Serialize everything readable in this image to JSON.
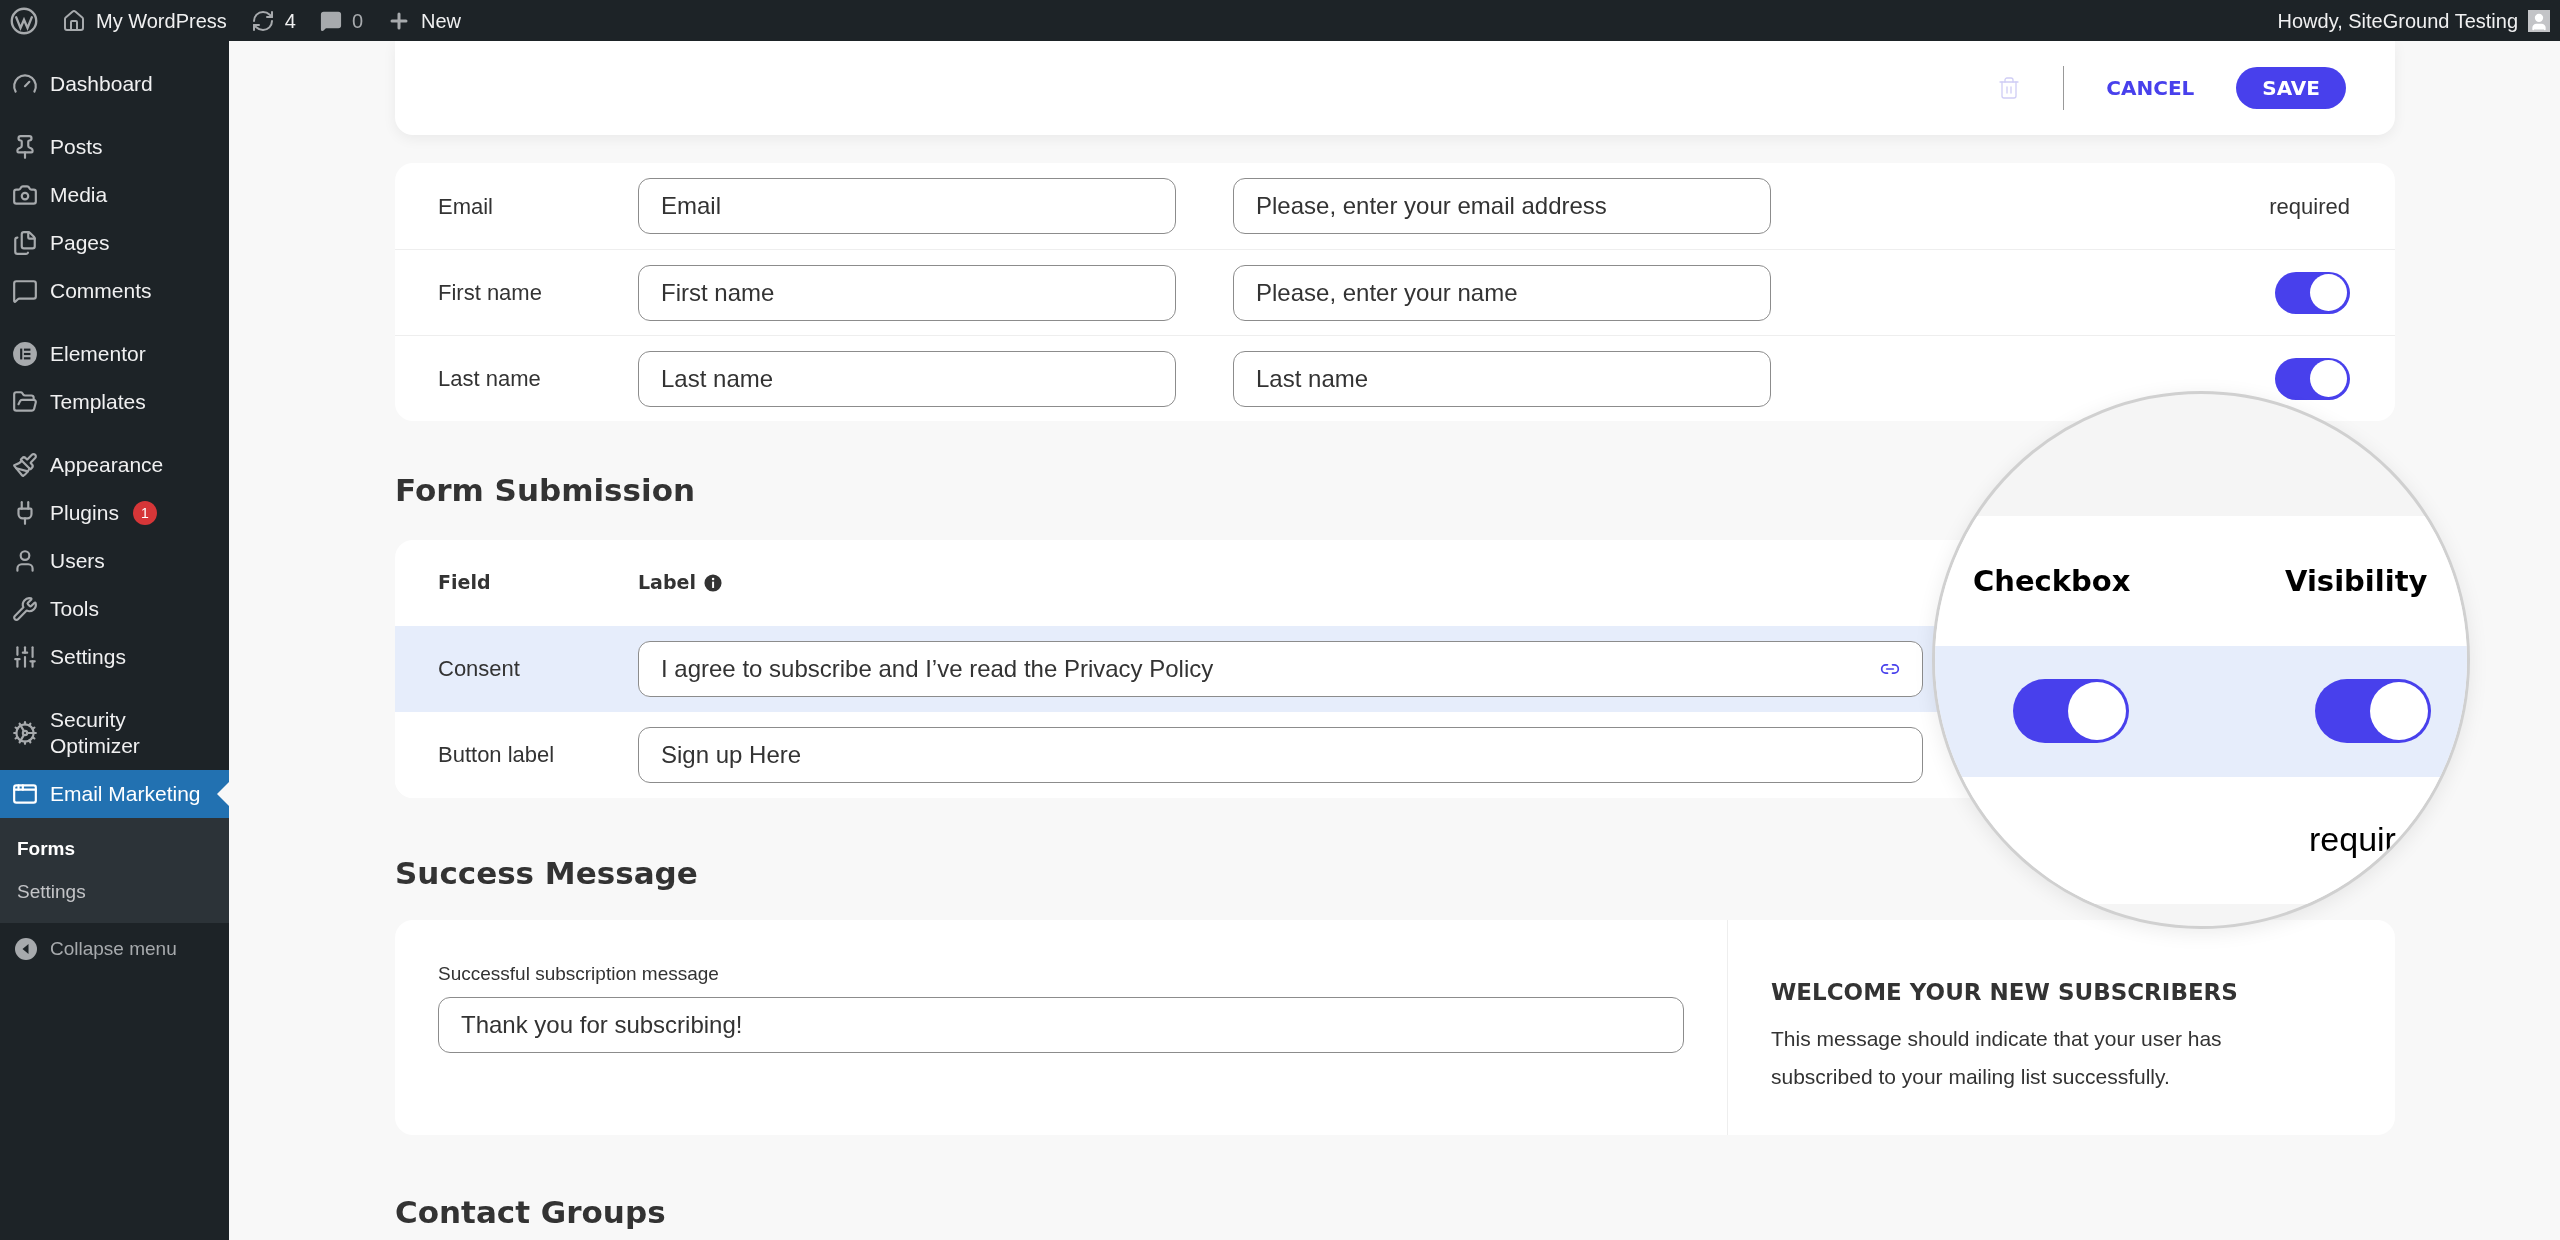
{
  "admin_bar": {
    "site_name": "My WordPress",
    "updates_count": "4",
    "comments_count": "0",
    "new_label": "New",
    "greeting": "Howdy, SiteGround Testing"
  },
  "sidebar": {
    "items": [
      {
        "label": "Dashboard",
        "selected": false
      },
      {
        "label": "Posts",
        "selected": false
      },
      {
        "label": "Media",
        "selected": false
      },
      {
        "label": "Pages",
        "selected": false
      },
      {
        "label": "Comments",
        "selected": false
      },
      {
        "label": "Elementor",
        "selected": false
      },
      {
        "label": "Templates",
        "selected": false
      },
      {
        "label": "Appearance",
        "selected": false
      },
      {
        "label": "Plugins",
        "badge": "1",
        "selected": false
      },
      {
        "label": "Users",
        "selected": false
      },
      {
        "label": "Tools",
        "selected": false
      },
      {
        "label": "Settings",
        "selected": false
      },
      {
        "label": "Security Optimizer",
        "selected": false
      },
      {
        "label": "Email Marketing",
        "selected": true,
        "children": [
          {
            "label": "Forms",
            "selected": true
          },
          {
            "label": "Settings",
            "selected": false
          }
        ]
      }
    ],
    "collapse_label": "Collapse menu"
  },
  "toolbar": {
    "delete_disabled": true,
    "buttons": [
      {
        "label": "CANCEL",
        "kind": "text"
      },
      {
        "label": "SAVE",
        "kind": "primary"
      }
    ]
  },
  "fields": {
    "rows": [
      {
        "label": "Email",
        "name_value": "Email",
        "prompt_value": "Please, enter your email address",
        "kind": "required",
        "required_text": "required"
      },
      {
        "label": "First name",
        "name_value": "First name",
        "prompt_value": "Please, enter your name",
        "kind": "toggle",
        "on": true
      },
      {
        "label": "Last name",
        "name_value": "Last name",
        "prompt_value": "Last name",
        "kind": "toggle",
        "on": true
      }
    ]
  },
  "form_submission": {
    "title": "Form Submission",
    "columns": [
      "Field",
      "Label"
    ],
    "rows": [
      {
        "field": "Consent",
        "value": "I agree to subscribe and I’ve read the Privacy Policy",
        "highlighted": true,
        "link": true
      },
      {
        "field": "Button label",
        "value": "Sign up Here",
        "highlighted": false,
        "link": false
      }
    ]
  },
  "magnifier": {
    "columns": [
      "Checkbox",
      "Visibility"
    ],
    "toggles": [
      {
        "on": true
      },
      {
        "on": true
      }
    ],
    "text": "requir"
  },
  "success_message": {
    "title": "Success Message",
    "field_label": "Successful subscription message",
    "value": "Thank you for subscribing!",
    "info_title": "WELCOME YOUR NEW SUBSCRIBERS",
    "info_text": "This message should indicate that your user has subscribed to your mailing list successfully."
  },
  "contact_groups": {
    "title": "Contact Groups"
  }
}
